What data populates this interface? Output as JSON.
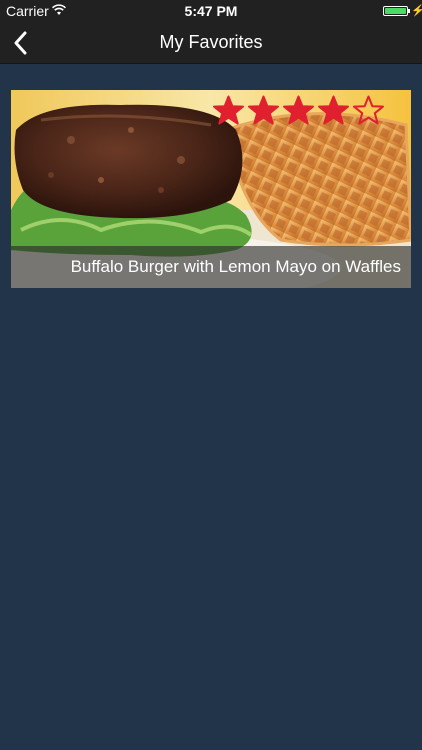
{
  "status_bar": {
    "carrier": "Carrier",
    "time": "5:47 PM",
    "battery_level": 1.0,
    "battery_color": "#4cd964"
  },
  "nav": {
    "title": "My Favorites",
    "back_icon": "chevron-left-icon"
  },
  "favorites": [
    {
      "title": "Buffalo Burger with Lemon Mayo on Waffles",
      "rating": 4,
      "max_rating": 5,
      "star_color": "#e0202e"
    }
  ],
  "colors": {
    "background": "#22344a",
    "bars": "#212121"
  }
}
